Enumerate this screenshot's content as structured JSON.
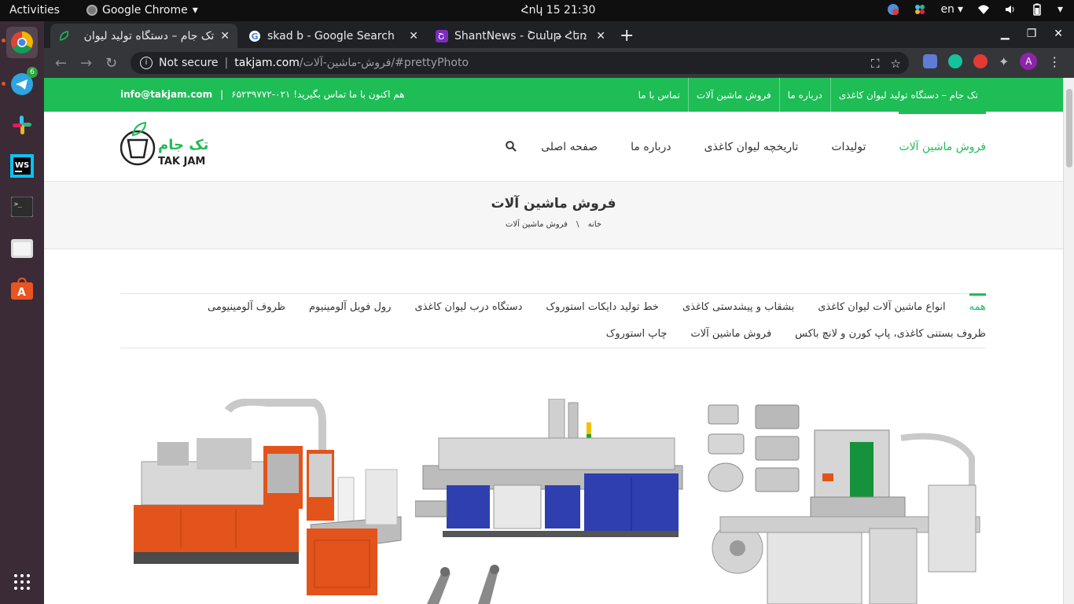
{
  "system": {
    "activities": "Activities",
    "app_name": "Google Chrome",
    "clock": "Հոկ 15  21:30",
    "language": "en"
  },
  "browser": {
    "tabs": [
      {
        "title": "تک جام – دستگاه تولید لیوان",
        "active": true
      },
      {
        "title": "skad b - Google Search",
        "active": false
      },
      {
        "title": "ShantNews - Շանթ Հեռ",
        "active": false
      }
    ],
    "security_label": "Not secure",
    "url_host": "takjam.com",
    "url_path": "/فروش-ماشین-آلات/#prettyPhoto",
    "profile_initial": "A"
  },
  "dock": {
    "telegram_badge": "6"
  },
  "site": {
    "topbar_contact": "هم اکنون با ما تماس بگیرید! ۰۲۱-۶۵۲۳۹۷۷۲",
    "topbar_email": "info@takjam.com",
    "topbar_sep": "|",
    "topbar_menu": [
      "تک جام – دستگاه تولید لیوان کاغذی",
      "درباره ما",
      "فروش ماشین آلات",
      "تماس با ما"
    ],
    "logo_text_fa": "تک جام",
    "logo_text_en": "TAK JAM",
    "main_nav": [
      "صفحه اصلی",
      "درباره ما",
      "تاریخچه لیوان کاغذی",
      "تولیدات",
      "فروش ماشین آلات"
    ],
    "page_title": "فروش ماشین آلات",
    "breadcrumb_home": "خانه",
    "breadcrumb_sep": "\\",
    "breadcrumb_current": "فروش ماشین آلات",
    "filters_row1": [
      "همه",
      "انواع ماشین آلات لیوان کاغذی",
      "بشقاب و پیشدستی کاغذی",
      "خط تولید دایکات استوروک",
      "دستگاه درب لیوان کاغذی",
      "رول فویل آلومینیوم",
      "ظروف آلومینیومی"
    ],
    "filters_row2": [
      "ظروف بستنی کاغذی، پاپ کورن و لانچ باکس",
      "فروش ماشین آلات",
      "چاپ استوروک"
    ]
  },
  "colors": {
    "brand_green": "#1ebd56",
    "machine_orange": "#e2541b",
    "machine_blue": "#2f3fb0"
  }
}
